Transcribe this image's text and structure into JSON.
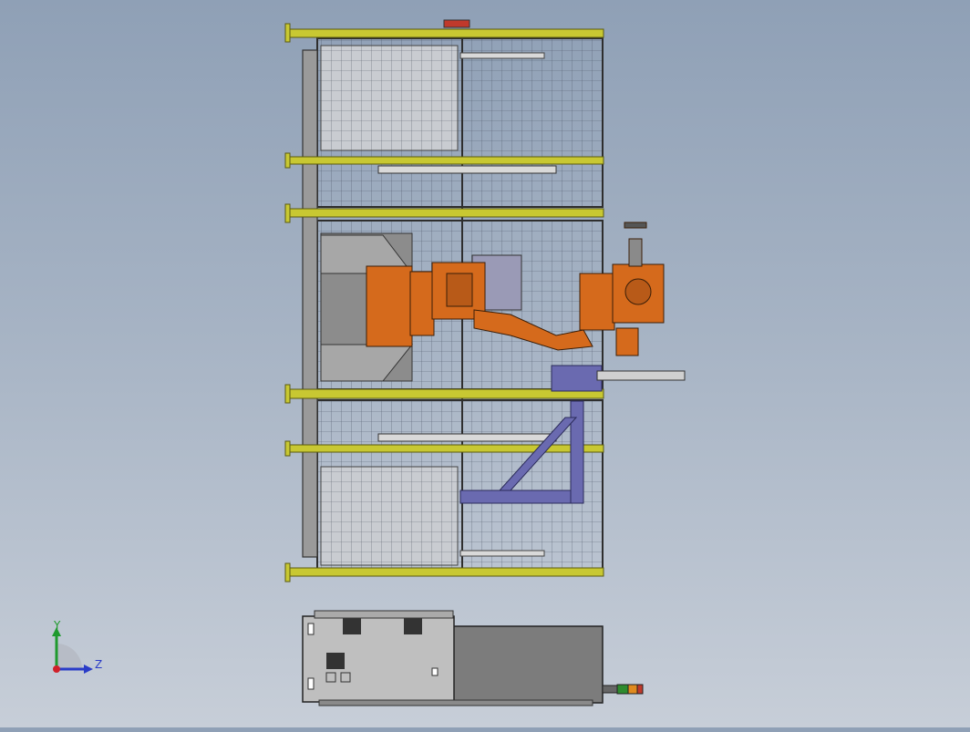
{
  "viewport": {
    "background_top": "#8fa0b6",
    "background_bottom": "#c7ced8"
  },
  "colors": {
    "rail": "#c8c832",
    "frame": "#3c3c3c",
    "mesh": "#50586a",
    "robot": "#d56a1c",
    "support": "#6a6ab0",
    "cabinet": "#8a8a8a"
  },
  "icons": {
    "triad": "coordinate-triad-icon",
    "stack_light": "stack-light-icon"
  },
  "triad": {
    "y_label": "Y",
    "z_label": "Z"
  }
}
